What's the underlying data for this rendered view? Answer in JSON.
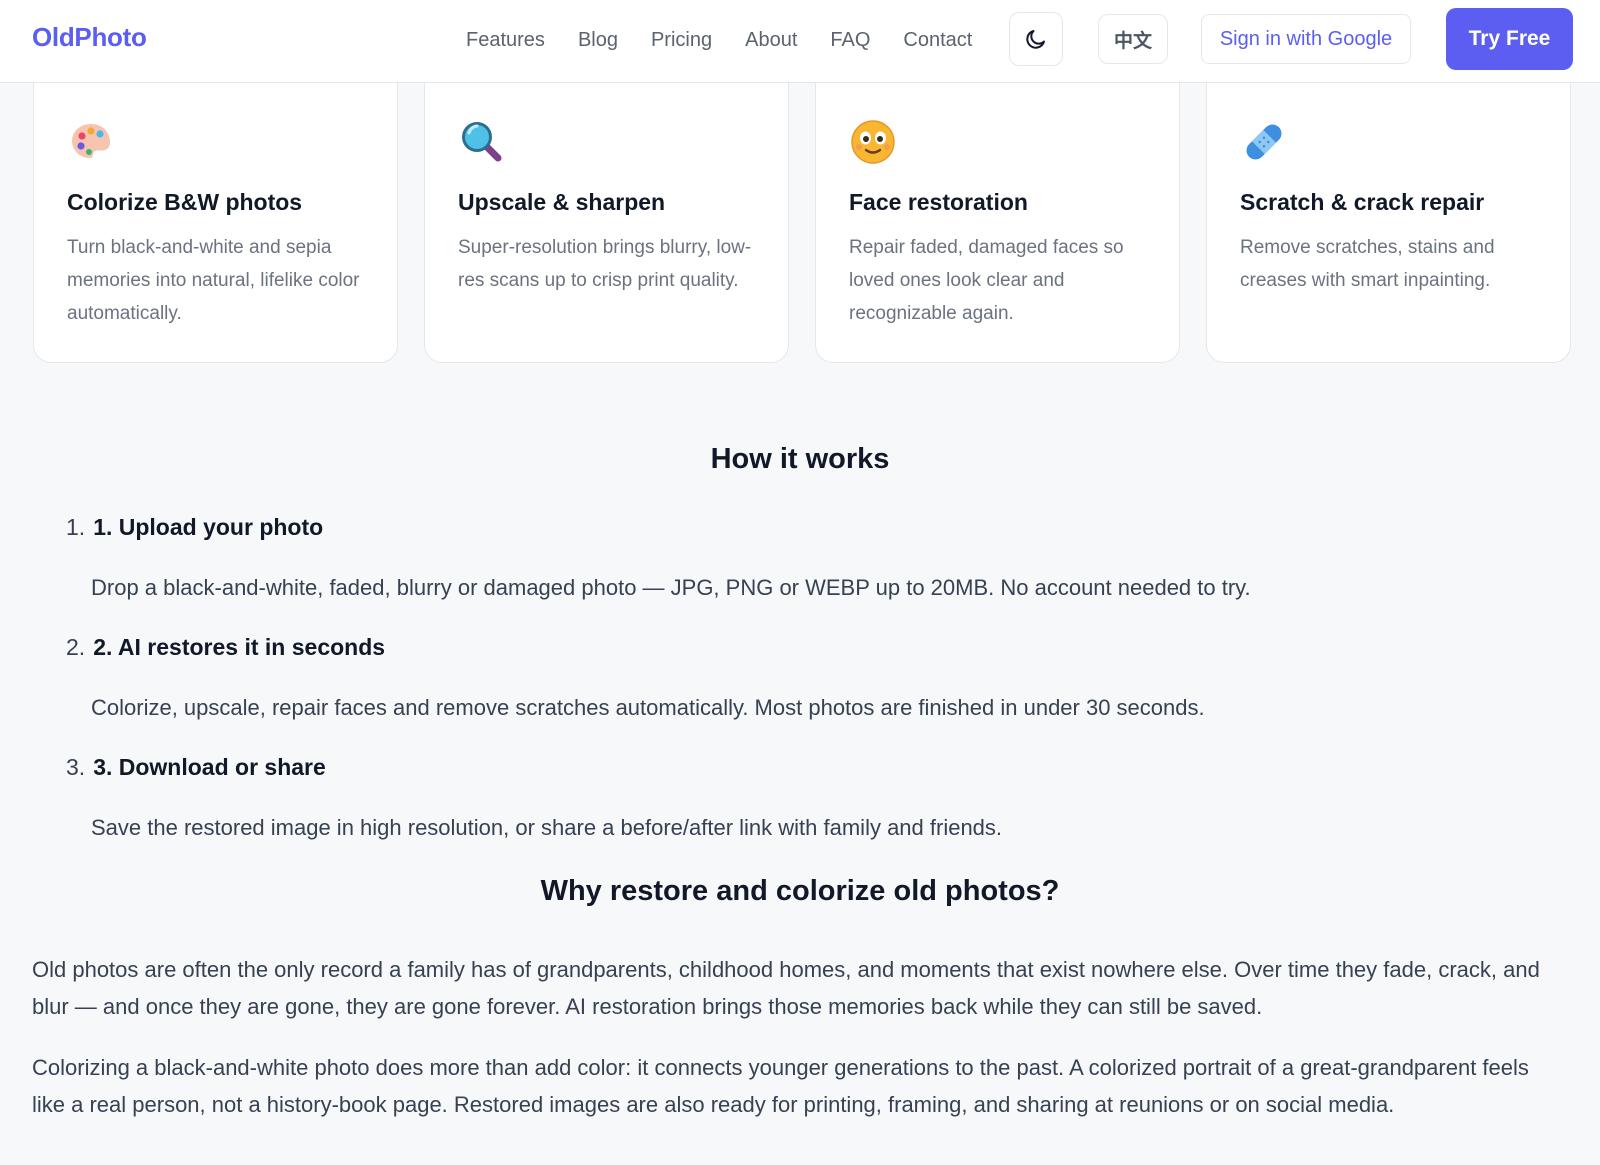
{
  "header": {
    "logo": "OldPhoto",
    "nav": [
      "Features",
      "Blog",
      "Pricing",
      "About",
      "FAQ",
      "Contact"
    ],
    "lang_label": "中文",
    "signin_label": "Sign in with Google",
    "try_label": "Try Free",
    "theme_icon": "moon-icon",
    "accent": "#5b5ef0"
  },
  "features": [
    {
      "icon": "palette-icon",
      "title": "Colorize B&W photos",
      "desc": "Turn black-and-white and sepia memories into natural, lifelike color automatically."
    },
    {
      "icon": "magnifier-icon",
      "title": "Upscale & sharpen",
      "desc": "Super-resolution brings blurry, low-res scans up to crisp print quality."
    },
    {
      "icon": "smiley-face-icon",
      "title": "Face restoration",
      "desc": "Repair faded, damaged faces so loved ones look clear and recognizable again."
    },
    {
      "icon": "bandage-icon",
      "title": "Scratch & crack repair",
      "desc": "Remove scratches, stains and creases with smart inpainting."
    }
  ],
  "how": {
    "title": "How it works",
    "steps": [
      {
        "num": "1.",
        "title": "1. Upload your photo",
        "desc": "Drop a black-and-white, faded, blurry or damaged photo — JPG, PNG or WEBP up to 20MB. No account needed to try."
      },
      {
        "num": "2.",
        "title": "2. AI restores it in seconds",
        "desc": "Colorize, upscale, repair faces and remove scratches automatically. Most photos are finished in under 30 seconds."
      },
      {
        "num": "3.",
        "title": "3. Download or share",
        "desc": "Save the restored image in high resolution, or share a before/after link with family and friends."
      }
    ]
  },
  "why": {
    "title": "Why restore and colorize old photos?",
    "paragraphs": [
      "Old photos are often the only record a family has of grandparents, childhood homes, and moments that exist nowhere else. Over time they fade, crack, and blur — and once they are gone, they are gone forever. AI restoration brings those memories back while they can still be saved.",
      "Colorizing a black-and-white photo does more than add color: it connects younger generations to the past. A colorized portrait of a great-grandparent feels like a real person, not a history-book page. Restored images are also ready for printing, framing, and sharing at reunions or on social media."
    ]
  }
}
